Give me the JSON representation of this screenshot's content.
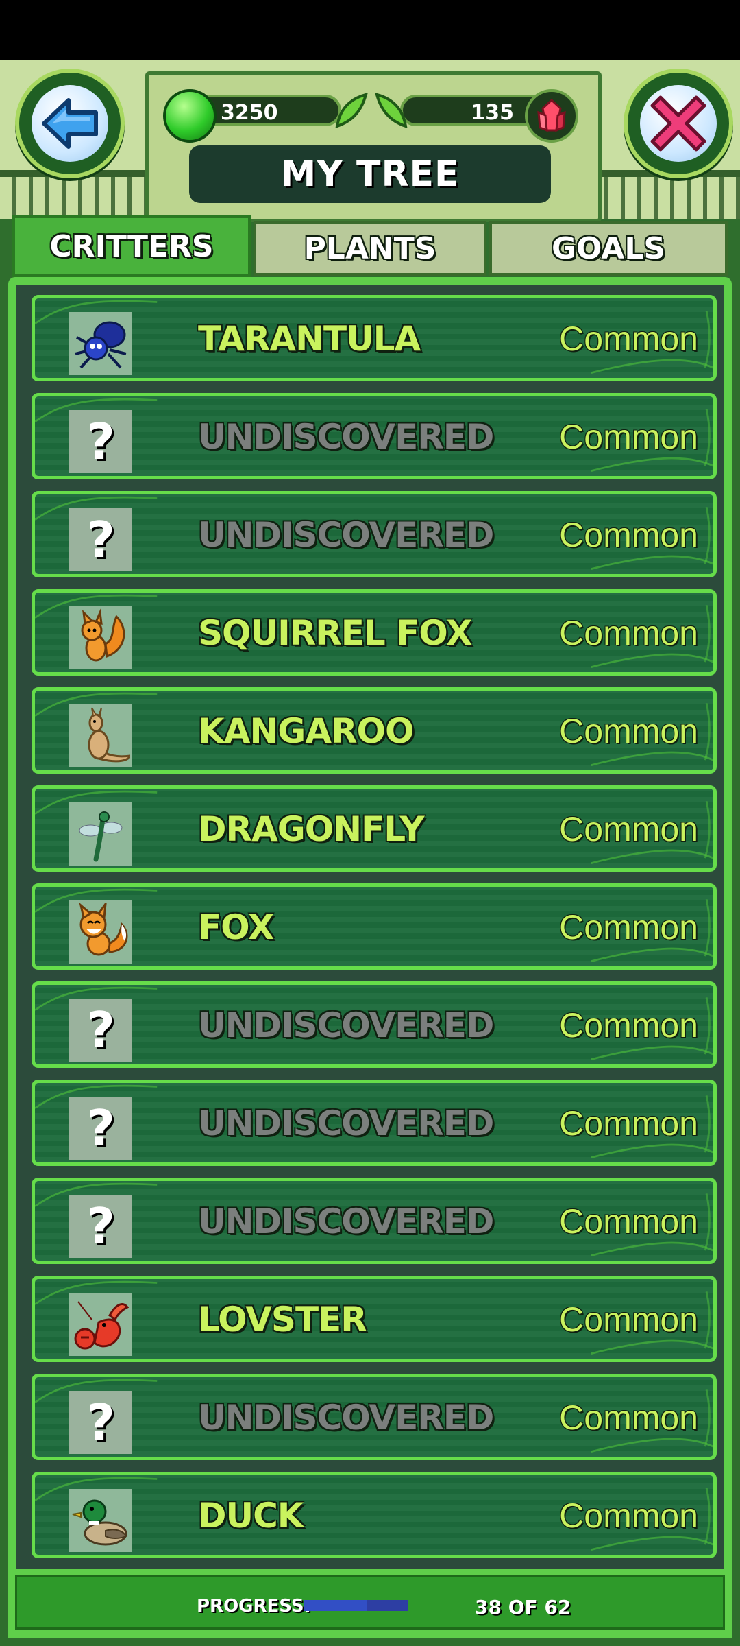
{
  "header": {
    "title": "MY TREE",
    "green_gems": "3250",
    "red_gems": "135"
  },
  "tabs": [
    {
      "label": "CRITTERS",
      "active": true
    },
    {
      "label": "PLANTS",
      "active": false
    },
    {
      "label": "GOALS",
      "active": false
    }
  ],
  "critters": [
    {
      "name": "TARANTULA",
      "rarity": "Common",
      "discovered": true,
      "icon": "tarantula-icon"
    },
    {
      "name": "UNDISCOVERED",
      "rarity": "Common",
      "discovered": false,
      "icon": "question-mark-icon"
    },
    {
      "name": "UNDISCOVERED",
      "rarity": "Common",
      "discovered": false,
      "icon": "question-mark-icon"
    },
    {
      "name": "SQUIRREL FOX",
      "rarity": "Common",
      "discovered": true,
      "icon": "squirrel-fox-icon"
    },
    {
      "name": "KANGAROO",
      "rarity": "Common",
      "discovered": true,
      "icon": "kangaroo-icon"
    },
    {
      "name": "DRAGONFLY",
      "rarity": "Common",
      "discovered": true,
      "icon": "dragonfly-icon"
    },
    {
      "name": "FOX",
      "rarity": "Common",
      "discovered": true,
      "icon": "fox-icon"
    },
    {
      "name": "UNDISCOVERED",
      "rarity": "Common",
      "discovered": false,
      "icon": "question-mark-icon"
    },
    {
      "name": "UNDISCOVERED",
      "rarity": "Common",
      "discovered": false,
      "icon": "question-mark-icon"
    },
    {
      "name": "UNDISCOVERED",
      "rarity": "Common",
      "discovered": false,
      "icon": "question-mark-icon"
    },
    {
      "name": "LOVSTER",
      "rarity": "Common",
      "discovered": true,
      "icon": "lobster-icon"
    },
    {
      "name": "UNDISCOVERED",
      "rarity": "Common",
      "discovered": false,
      "icon": "question-mark-icon"
    },
    {
      "name": "DUCK",
      "rarity": "Common",
      "discovered": true,
      "icon": "duck-icon"
    }
  ],
  "progress": {
    "label": "PROGRESS:",
    "count_text": "38 OF 62",
    "fraction": 0.613
  },
  "unknown_glyph": "?",
  "colors": {
    "row_fill": "#1d6b3c",
    "row_border": "#66dd4a",
    "name_discovered": "#c9f25e",
    "name_undiscovered": "#7b7f7d",
    "progress_fill": "#324fc5"
  }
}
